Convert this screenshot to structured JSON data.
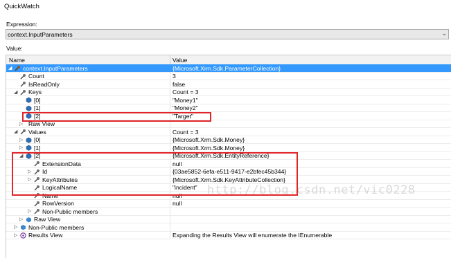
{
  "window": {
    "title": "QuickWatch"
  },
  "expression": {
    "label": "Expression:",
    "value": "context.InputParameters"
  },
  "value_label": "Value:",
  "grid": {
    "col_name": "Name",
    "col_value": "Value",
    "rows": [
      {
        "name": "context.InputParameters",
        "value": "{Microsoft.Xrm.Sdk.ParameterCollection}",
        "depth": 0,
        "expand": "open",
        "icon": "wrench-icon",
        "selected": true
      },
      {
        "name": "Count",
        "value": "3",
        "depth": 1,
        "expand": "none",
        "icon": "property-icon"
      },
      {
        "name": "IsReadOnly",
        "value": "false",
        "depth": 1,
        "expand": "none",
        "icon": "property-icon"
      },
      {
        "name": "Keys",
        "value": "Count = 3",
        "depth": 1,
        "expand": "open",
        "icon": "property-icon"
      },
      {
        "name": "[0]",
        "value": "\"Money1\"",
        "depth": 2,
        "expand": "none",
        "icon": "field-icon"
      },
      {
        "name": "[1]",
        "value": "\"Money2\"",
        "depth": 2,
        "expand": "none",
        "icon": "field-icon"
      },
      {
        "name": "[2]",
        "value": "\"Target\"",
        "depth": 2,
        "expand": "none",
        "icon": "field-icon"
      },
      {
        "name": "Raw View",
        "value": "",
        "depth": 2,
        "expand": "closed",
        "icon": "none"
      },
      {
        "name": "Values",
        "value": "Count = 3",
        "depth": 1,
        "expand": "open",
        "icon": "property-icon"
      },
      {
        "name": "[0]",
        "value": "{Microsoft.Xrm.Sdk.Money}",
        "depth": 2,
        "expand": "closed",
        "icon": "field-icon"
      },
      {
        "name": "[1]",
        "value": "{Microsoft.Xrm.Sdk.Money}",
        "depth": 2,
        "expand": "closed",
        "icon": "field-icon"
      },
      {
        "name": "[2]",
        "value": "{Microsoft.Xrm.Sdk.EntityReference}",
        "depth": 2,
        "expand": "open",
        "icon": "field-icon"
      },
      {
        "name": "ExtensionData",
        "value": "null",
        "depth": 3,
        "expand": "none",
        "icon": "property-icon"
      },
      {
        "name": "Id",
        "value": "{03ae5852-6efa-e511-9417-e2bfec45b344}",
        "depth": 3,
        "expand": "closed",
        "icon": "property-icon"
      },
      {
        "name": "KeyAttributes",
        "value": "{Microsoft.Xrm.Sdk.KeyAttributeCollection}",
        "depth": 3,
        "expand": "closed",
        "icon": "property-icon"
      },
      {
        "name": "LogicalName",
        "value": "\"incident\"",
        "depth": 3,
        "expand": "none",
        "icon": "property-icon"
      },
      {
        "name": "Name",
        "value": "null",
        "depth": 3,
        "expand": "none",
        "icon": "property-icon"
      },
      {
        "name": "RowVersion",
        "value": "null",
        "depth": 3,
        "expand": "none",
        "icon": "property-icon"
      },
      {
        "name": "Non-Public members",
        "value": "",
        "depth": 3,
        "expand": "closed",
        "icon": "property-icon"
      },
      {
        "name": "Raw View",
        "value": "",
        "depth": 2,
        "expand": "closed",
        "icon": "raw-icon"
      },
      {
        "name": "Non-Public members",
        "value": "",
        "depth": 1,
        "expand": "closed",
        "icon": "raw-icon"
      },
      {
        "name": "Results View",
        "value": "Expanding the Results View will enumerate the IEnumerable",
        "depth": 1,
        "expand": "closed",
        "icon": "results-icon"
      }
    ]
  },
  "watermark": "http://blog.csdn.net/vic0228",
  "colors": {
    "selection": "#3399ff",
    "highlight": "#e0252a",
    "field_icon": "#2f6fb5"
  }
}
